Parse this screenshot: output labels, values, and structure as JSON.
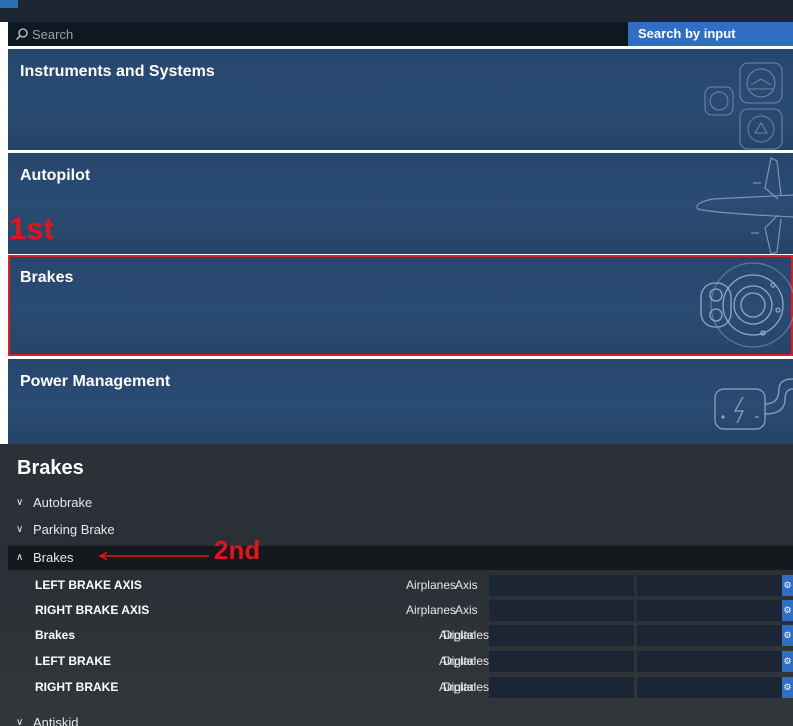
{
  "search": {
    "placeholder": "Search",
    "button_label": "Search by input"
  },
  "categories": [
    {
      "label": "Instruments and Systems",
      "icon": "instruments-icon"
    },
    {
      "label": "Autopilot",
      "icon": "airplane-icon"
    },
    {
      "label": "Brakes",
      "icon": "brake-disc-icon",
      "highlighted": true
    },
    {
      "label": "Power Management",
      "icon": "battery-bolt-icon"
    }
  ],
  "annotations": {
    "first": "1st",
    "second": "2nd",
    "color": "#e0161b"
  },
  "detail": {
    "title": "Brakes",
    "groups": {
      "autobrake": "Autobrake",
      "parking": "Parking Brake",
      "brakes": "Brakes",
      "antiskid": "Antiskid"
    },
    "rows": [
      {
        "name": "LEFT BRAKE AXIS",
        "category": "Airplanes",
        "kind": "Axis"
      },
      {
        "name": "RIGHT BRAKE AXIS",
        "category": "Airplanes",
        "kind": "Axis"
      },
      {
        "name": "Brakes",
        "category": "Airplanes",
        "kind": "Digital"
      },
      {
        "name": "LEFT BRAKE",
        "category": "Airplanes",
        "kind": "Digital"
      },
      {
        "name": "RIGHT BRAKE",
        "category": "Airplanes",
        "kind": "Digital"
      }
    ]
  },
  "colors": {
    "accent": "#2f6ec2",
    "card": "#28486f",
    "highlight": "#d42222"
  }
}
